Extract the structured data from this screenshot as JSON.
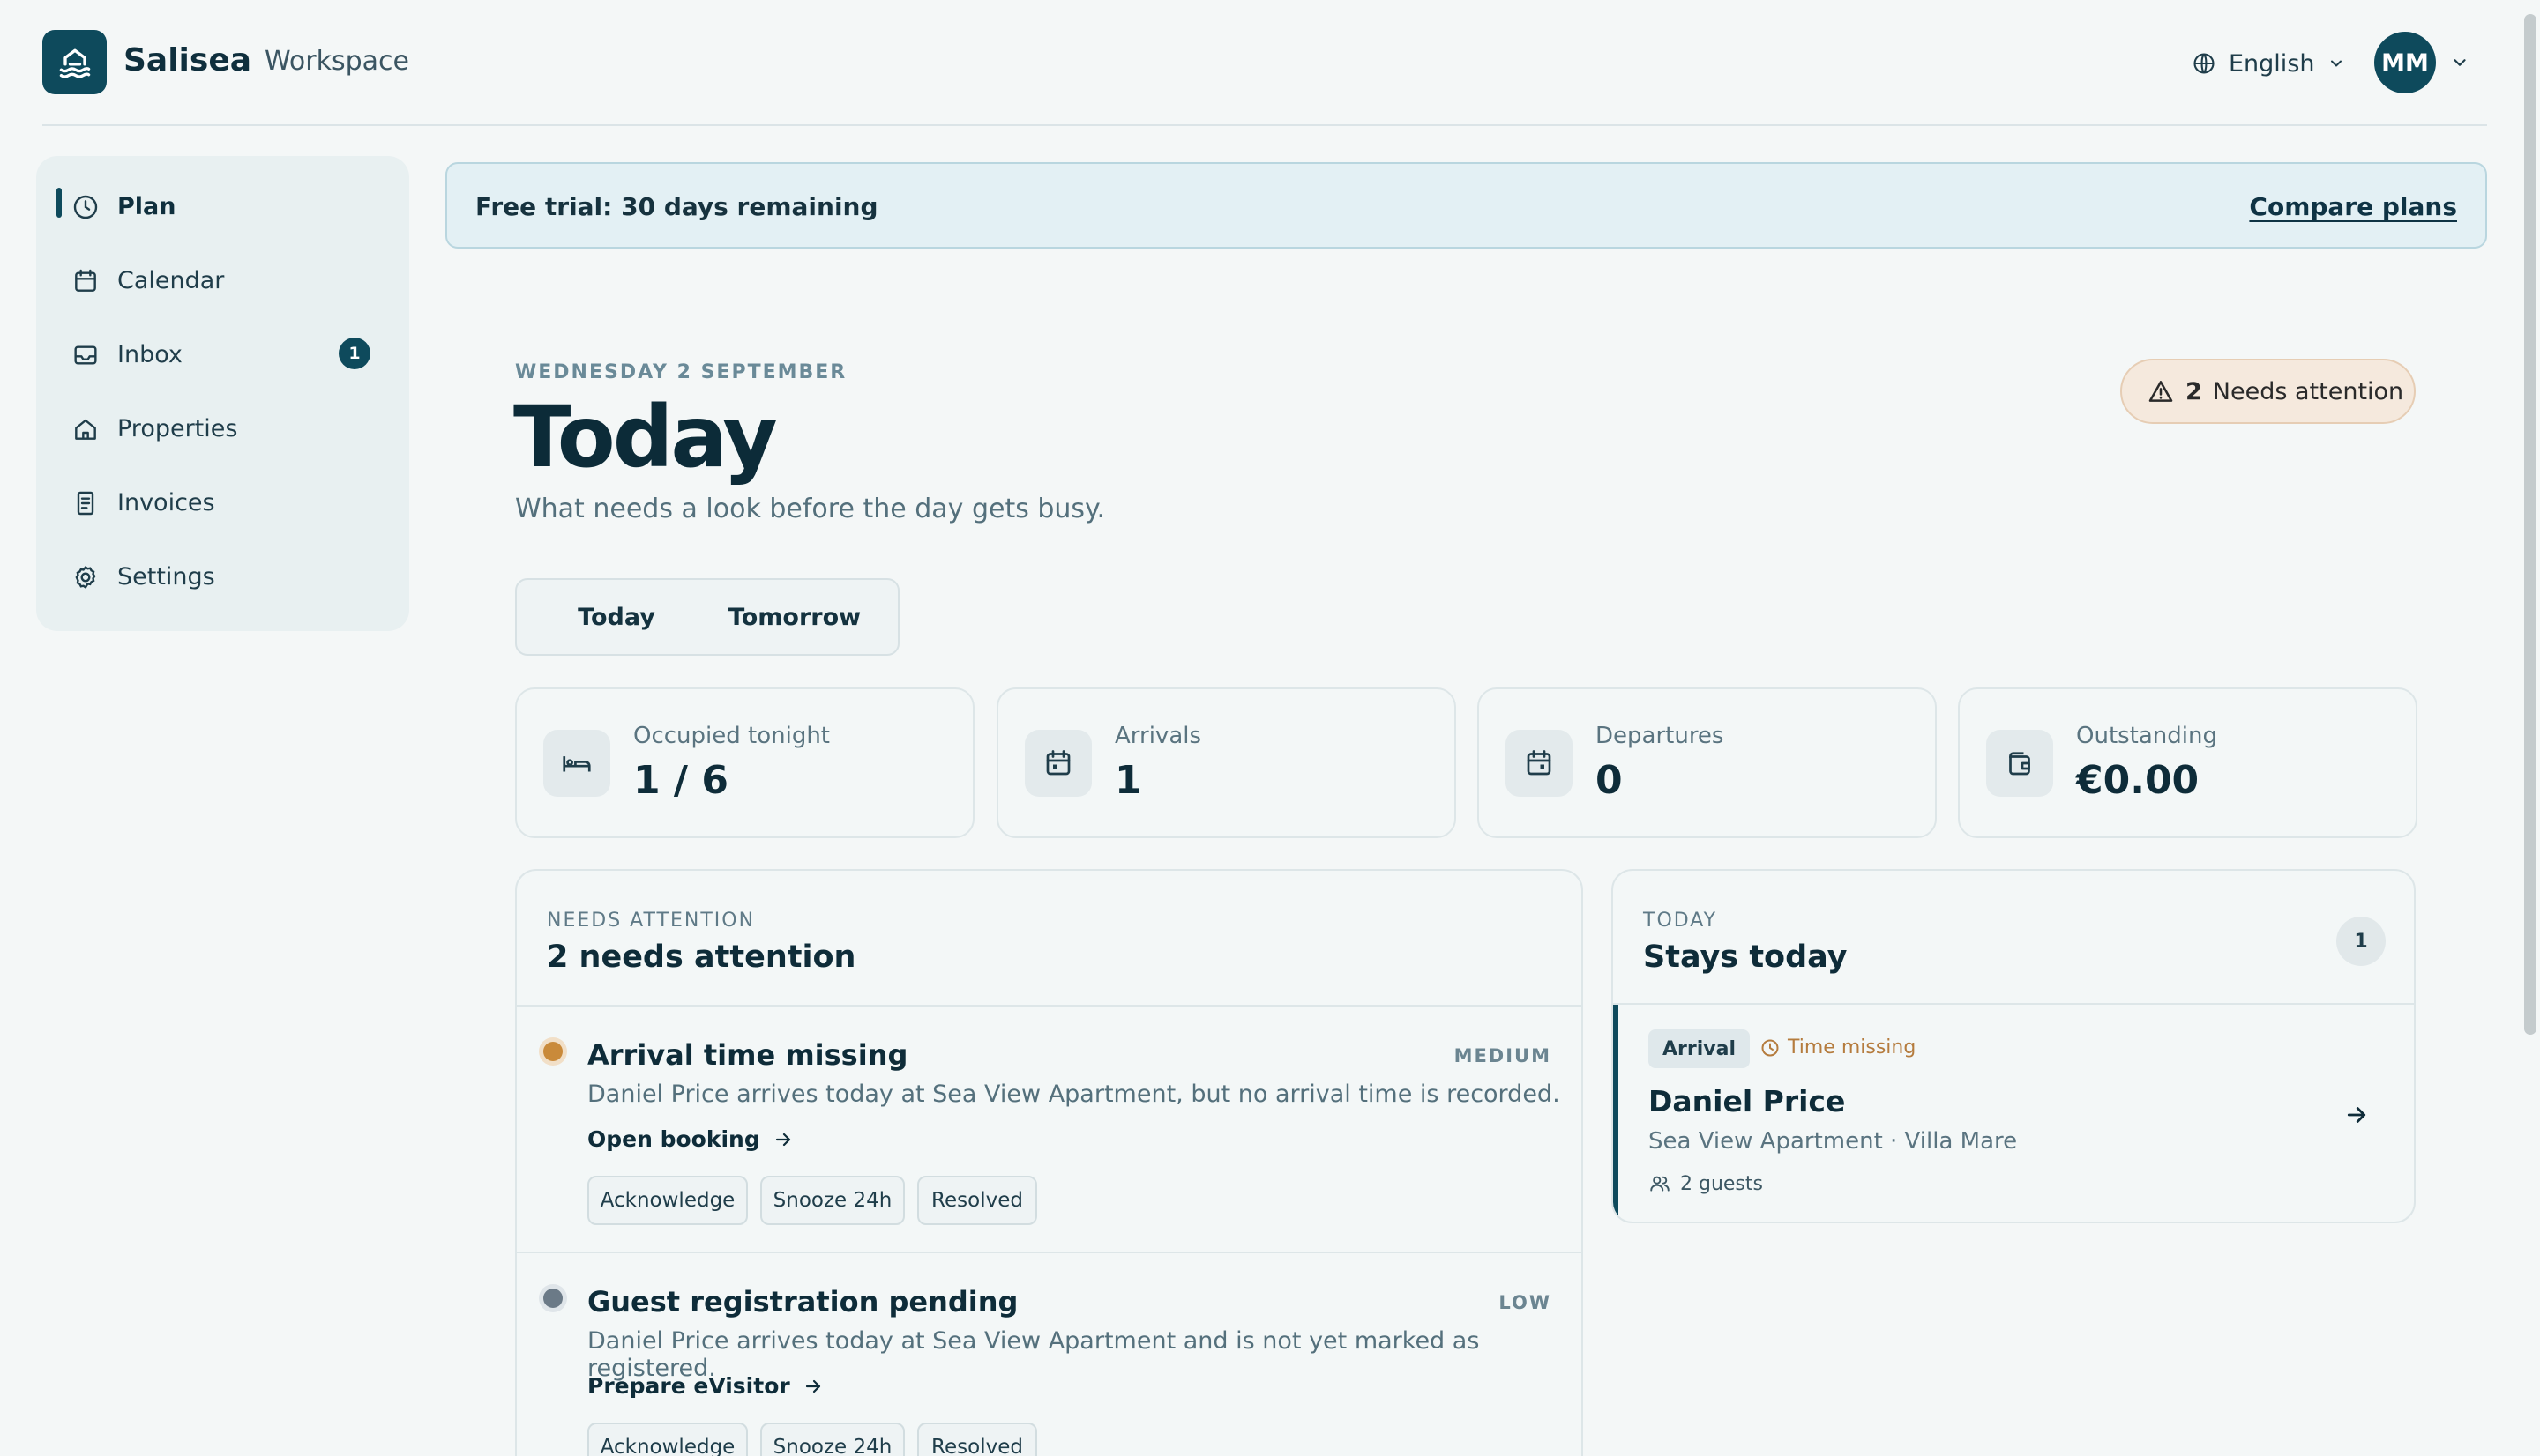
{
  "app": {
    "brand": "Salisea",
    "workspace": "Workspace"
  },
  "header": {
    "language": "English",
    "user_initials": "MM"
  },
  "sidebar": {
    "items": [
      {
        "label": "Plan",
        "icon": "clock-icon",
        "active": true
      },
      {
        "label": "Calendar",
        "icon": "calendar-icon"
      },
      {
        "label": "Inbox",
        "icon": "inbox-icon",
        "badge": "1"
      },
      {
        "label": "Properties",
        "icon": "home-icon"
      },
      {
        "label": "Invoices",
        "icon": "receipt-icon"
      },
      {
        "label": "Settings",
        "icon": "gear-icon"
      }
    ]
  },
  "trial": {
    "text": "Free trial: 30 days remaining",
    "link": "Compare plans"
  },
  "page": {
    "date": "WEDNESDAY 2 SEPTEMBER",
    "title": "Today",
    "subtitle": "What needs a look before the day gets busy.",
    "attention_count": "2",
    "attention_label": "Needs attention"
  },
  "segment": {
    "options": [
      "Today",
      "Tomorrow"
    ],
    "selected": "Today"
  },
  "stats": [
    {
      "label": "Occupied tonight",
      "value": "1 / 6",
      "icon": "bed-icon"
    },
    {
      "label": "Arrivals",
      "value": "1",
      "icon": "calendar-icon"
    },
    {
      "label": "Departures",
      "value": "0",
      "icon": "calendar-icon"
    },
    {
      "label": "Outstanding",
      "value": "€0.00",
      "icon": "wallet-icon"
    }
  ],
  "attention_panel": {
    "eyebrow": "NEEDS ATTENTION",
    "title": "2 needs attention",
    "items": [
      {
        "title": "Arrival time missing",
        "level": "MEDIUM",
        "level_color": "#c98a3a",
        "description": "Daniel Price arrives today at Sea View Apartment, but no arrival time is recorded.",
        "link": "Open booking",
        "actions": [
          "Acknowledge",
          "Snooze 24h",
          "Resolved"
        ]
      },
      {
        "title": "Guest registration pending",
        "level": "LOW",
        "level_color": "#6b7a87",
        "description": "Daniel Price arrives today at Sea View Apartment and is not yet marked as registered.",
        "link": "Prepare eVisitor",
        "actions": [
          "Acknowledge",
          "Snooze 24h",
          "Resolved"
        ]
      }
    ]
  },
  "stays_panel": {
    "eyebrow": "TODAY",
    "title": "Stays today",
    "count": "1",
    "stay": {
      "tag": "Arrival",
      "warning": "Time missing",
      "guest": "Daniel Price",
      "place": "Sea View Apartment · Villa Mare",
      "guests": "2 guests"
    }
  },
  "colors": {
    "brand": "#0e4a5c",
    "background": "#f4f7f7",
    "warning": "#c98a3a"
  }
}
